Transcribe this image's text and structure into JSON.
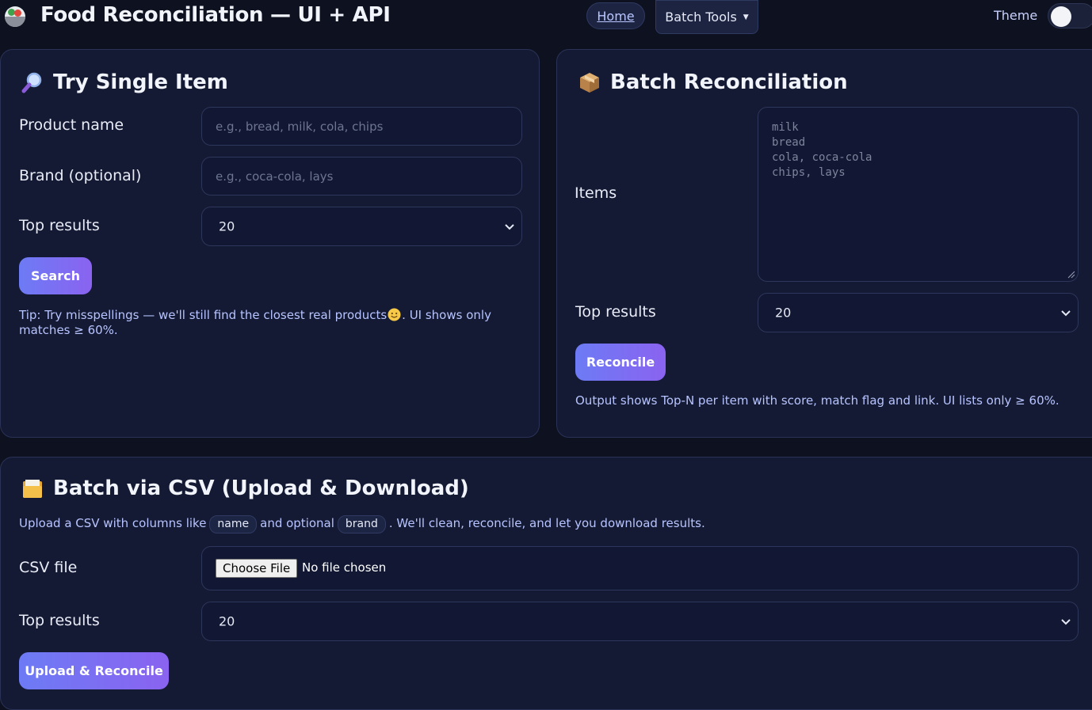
{
  "header": {
    "app_title": "Food Reconciliation — UI + API",
    "nav_home": "Home",
    "nav_batch_tools": "Batch Tools",
    "theme_label": "Theme",
    "logo_icon": "salad-bowl-icon"
  },
  "single": {
    "title": "Try Single Item",
    "icon": "magnifier-icon",
    "product_label": "Product name",
    "product_placeholder": "e.g., bread, milk, cola, chips",
    "brand_label": "Brand (optional)",
    "brand_placeholder": "e.g., coca-cola, lays",
    "top_label": "Top results",
    "top_value": "20",
    "search_button": "Search",
    "tip_line1": "Tip: Try misspellings — we'll still find the closest real products",
    "tip_line1_end": ". UI shows only",
    "tip_line2": "matches ≥ 60%."
  },
  "batch": {
    "title": "Batch Reconciliation",
    "icon": "package-icon",
    "items_label": "Items",
    "items_placeholder": "milk\nbread\ncola, coca-cola\nchips, lays",
    "top_label": "Top results",
    "top_value": "20",
    "reconcile_button": "Reconcile",
    "note": "Output shows Top-N per item with score, match flag and link. UI lists only ≥ 60%."
  },
  "csv": {
    "title": "Batch via CSV (Upload & Download)",
    "icon": "folder-icon",
    "desc_pre": "Upload a CSV with columns like",
    "code_name": "name",
    "desc_mid": "and optional",
    "code_brand": "brand",
    "desc_post": ". We'll clean, reconcile, and let you download results.",
    "file_label": "CSV file",
    "choose_file": "Choose File",
    "no_file": "No file chosen",
    "top_label": "Top results",
    "top_value": "20",
    "upload_button": "Upload & Reconcile"
  }
}
